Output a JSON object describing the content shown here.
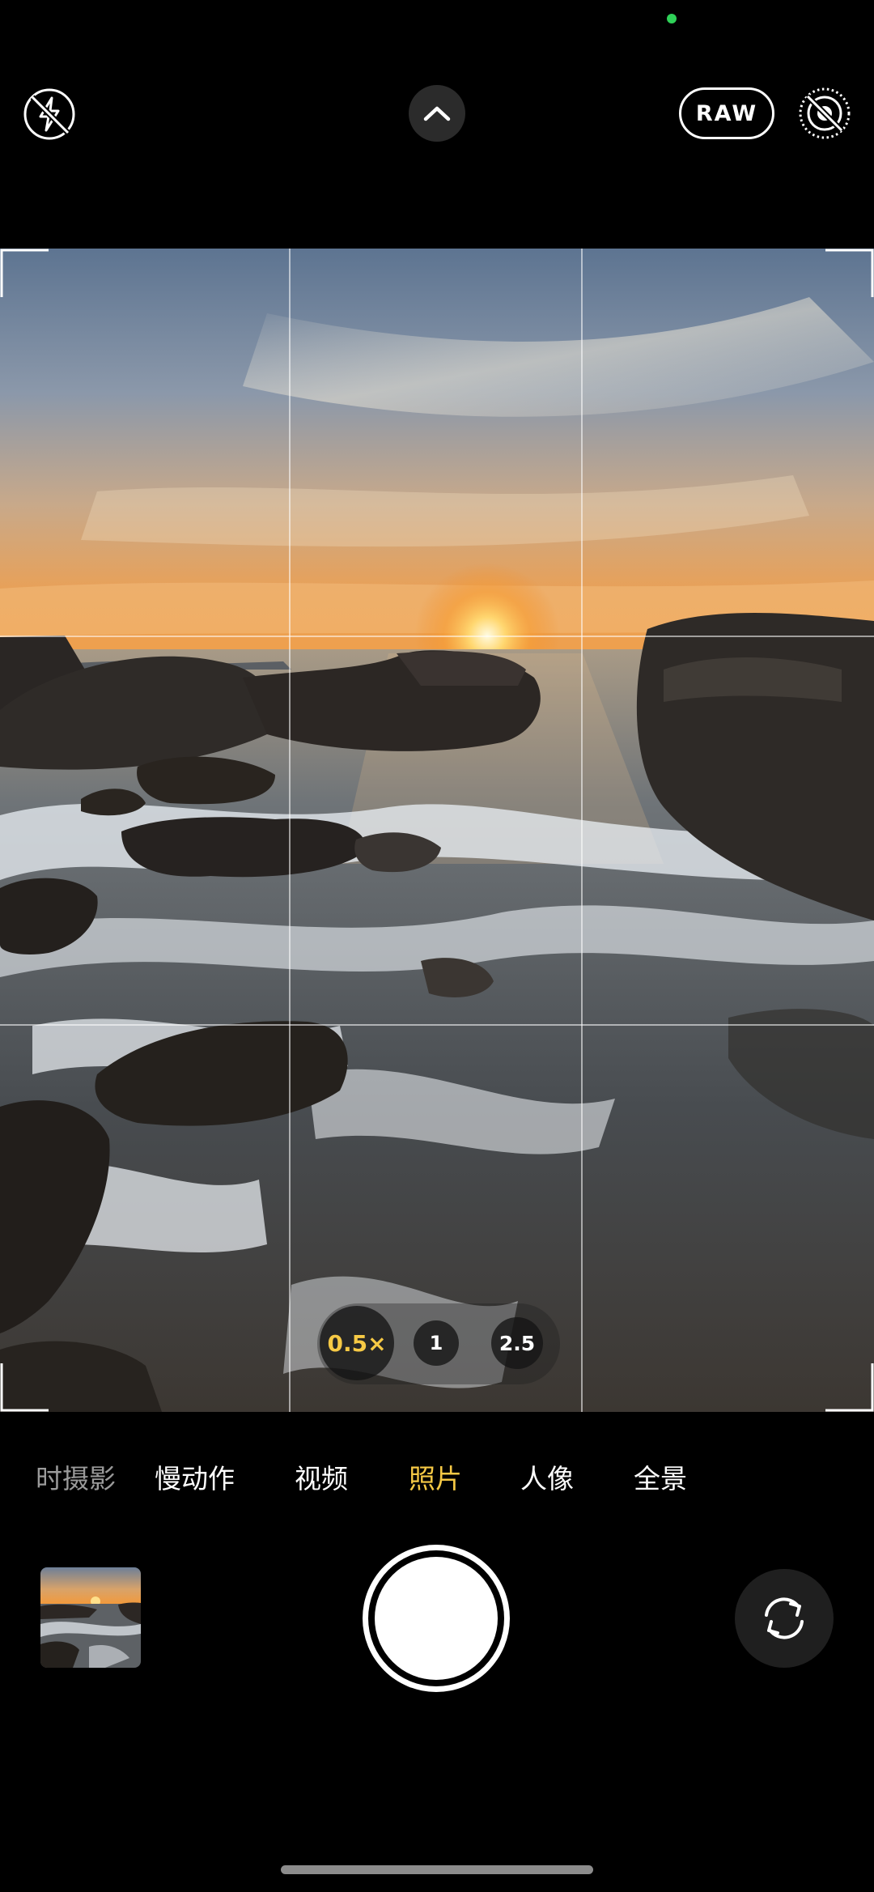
{
  "top_bar": {
    "flash_icon": "flash-off-icon",
    "chevron_icon": "chevron-up-icon",
    "raw_label": "RAW",
    "live_icon": "live-photo-off-icon"
  },
  "zoom": {
    "options": [
      "0.5×",
      "1",
      "2.5"
    ],
    "active": "0.5×",
    "active_color": "#f6c945"
  },
  "modes": {
    "items": [
      "延时摄影",
      "慢动作",
      "视频",
      "照片",
      "人像",
      "全景"
    ],
    "visible_partial": "时摄影",
    "active": "照片",
    "active_color": "#f6c945"
  },
  "bottom": {
    "thumbnail_icon": "last-photo-thumbnail",
    "shutter_icon": "shutter-button",
    "flip_icon": "camera-flip-icon"
  },
  "viewfinder": {
    "grid": "3x3",
    "scene": "sunset over rocky shore with waves"
  }
}
